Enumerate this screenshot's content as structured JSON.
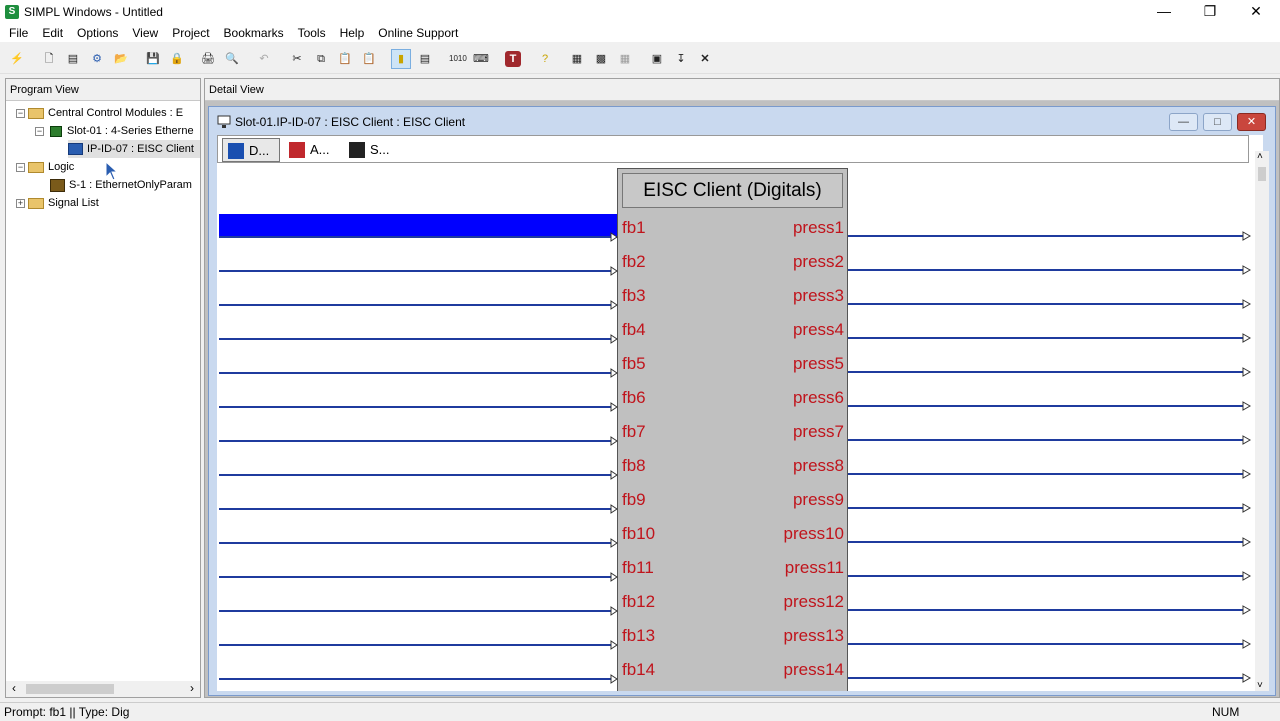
{
  "window": {
    "title": "SIMPL Windows - Untitled"
  },
  "menu": [
    "File",
    "Edit",
    "Options",
    "View",
    "Project",
    "Bookmarks",
    "Tools",
    "Help",
    "Online Support"
  ],
  "program_view": {
    "header": "Program View",
    "tree": [
      {
        "label": "Central Control Modules : E",
        "level": 0,
        "expander": "−",
        "icon": "folder-icon"
      },
      {
        "label": "Slot-01 : 4-Series Etherne",
        "level": 1,
        "expander": "−",
        "icon": "chip-icon"
      },
      {
        "label": "IP-ID-07 : EISC Client",
        "level": 2,
        "expander": "",
        "icon": "monitor-icon",
        "selected": true
      },
      {
        "label": "Logic",
        "level": 0,
        "expander": "−",
        "icon": "folder-icon"
      },
      {
        "label": "S-1 : EthernetOnlyParam",
        "level": 1,
        "expander": "",
        "icon": "logic-icon"
      },
      {
        "label": "Signal List",
        "level": 0,
        "expander": "+",
        "icon": "folder-icon"
      }
    ]
  },
  "detail_view": {
    "header": "Detail View"
  },
  "child_window": {
    "title": "Slot-01.IP-ID-07 : EISC Client : EISC Client",
    "tabs": [
      {
        "label": "D...",
        "icon": "digital-icon"
      },
      {
        "label": "A...",
        "icon": "analog-icon"
      },
      {
        "label": "S...",
        "icon": "serial-icon"
      }
    ],
    "symbol": {
      "title": "EISC Client (Digitals)",
      "inputs": [
        "fb1",
        "fb2",
        "fb3",
        "fb4",
        "fb5",
        "fb6",
        "fb7",
        "fb8",
        "fb9",
        "fb10",
        "fb11",
        "fb12",
        "fb13",
        "fb14"
      ],
      "outputs": [
        "press1",
        "press2",
        "press3",
        "press4",
        "press5",
        "press6",
        "press7",
        "press8",
        "press9",
        "press10",
        "press11",
        "press12",
        "press13",
        "press14"
      ]
    }
  },
  "status": {
    "prompt": "Prompt: fb1 || Type: Dig",
    "num": "NUM"
  },
  "colors": {
    "signal_line": "#1f3b9e",
    "selection": "#0000ff",
    "pin_label": "#c0141c",
    "symbol_bg": "#c0c0c0"
  }
}
